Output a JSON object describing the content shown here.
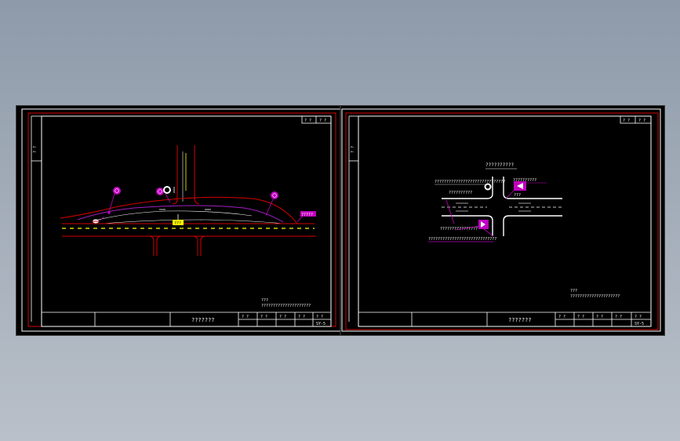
{
  "left_sheet": {
    "sheet_no": "? ?",
    "sheet_total": "? ?",
    "side_label": "? ?",
    "note_line1": "???",
    "note_line2": "?????????????????????",
    "title": "???????",
    "tb_cells": [
      "? ?",
      "? ?",
      "? ?",
      "? ?",
      "? ?"
    ],
    "drawing_no": "SY-5",
    "sign_label": "???",
    "post_label": "?????"
  },
  "right_sheet": {
    "sheet_no": "? ?",
    "sheet_total": "? ?",
    "side_label": "? ?",
    "heading": "??????????",
    "note_line1": "???",
    "note_line2": "?????????????????????",
    "title": "???????",
    "tb_cells": [
      "? ?",
      "? ?",
      "? ?",
      "? ?",
      "? ?"
    ],
    "drawing_no": "SY-5",
    "ann1": "??????????????????????????????",
    "ann2": "??????????",
    "ann3": "????????????????",
    "ann4": "?????????????????????????????",
    "ann5": "??????????",
    "ann6": "???"
  },
  "colors": {
    "frame": "#d40000",
    "linework": "#ffffff",
    "sign": "#c000c0",
    "centerline": "#ffff00"
  }
}
